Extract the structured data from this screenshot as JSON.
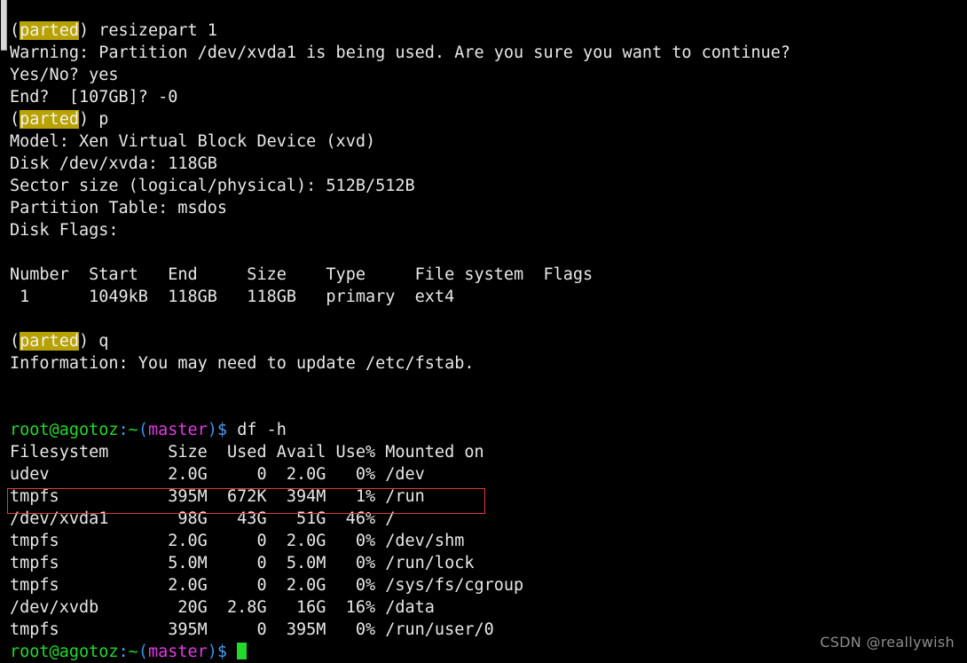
{
  "terminal": {
    "background": "#000000",
    "foreground": "#e8e8e8",
    "prompt_user_host": "root@agotoz",
    "prompt_colors": {
      "user_host": "#23d92c",
      "colon": "#4a9ef5",
      "path": "#23d92c",
      "paren": "#3a8fe8",
      "branch": "#e23be2",
      "dollar": "#4a9ef5"
    },
    "parted_highlight_bg": "#b8a200",
    "annotation_box_color": "#e03b3b",
    "cursor_color": "#23d92c"
  },
  "parted_session": {
    "prompt_open": "(",
    "prompt_name": "parted",
    "prompt_close": ") ",
    "cmd_resizepart": "resizepart 1",
    "warning": "Warning: Partition /dev/xvda1 is being used. Are you sure you want to continue?",
    "yesno_prompt": "Yes/No? yes",
    "end_prompt": "End?  [107GB]? -0",
    "cmd_print": "p",
    "cmd_quit": "q",
    "info": "Information: You may need to update /etc/fstab.",
    "disk_info": [
      "Model: Xen Virtual Block Device (xvd)",
      "Disk /dev/xvda: 118GB",
      "Sector size (logical/physical): 512B/512B",
      "Partition Table: msdos",
      "Disk Flags:"
    ],
    "partition_table": {
      "header": "Number  Start   End     Size    Type     File system  Flags",
      "rows": [
        " 1      1049kB  118GB   118GB   primary  ext4"
      ]
    }
  },
  "prompt_lines": {
    "line_df": {
      "user_host": "root@agotoz",
      "colon": ":",
      "path": "~",
      "open_paren": "(",
      "branch": "master",
      "close_paren": ")",
      "dollar": "$",
      "command": " df -h"
    },
    "line_last": {
      "user_host": "root@agotoz",
      "colon": ":",
      "path": "~",
      "open_paren": "(",
      "branch": "master",
      "close_paren": ")",
      "dollar": "$",
      "command": " "
    }
  },
  "df_output": {
    "header": "Filesystem      Size  Used Avail Use% Mounted on",
    "rows": [
      "udev            2.0G     0  2.0G   0% /dev",
      "tmpfs           395M  672K  394M   1% /run",
      "/dev/xvda1       98G   43G   51G  46% /",
      "tmpfs           2.0G     0  2.0G   0% /dev/shm",
      "tmpfs           5.0M     0  5.0M   0% /run/lock",
      "tmpfs           2.0G     0  2.0G   0% /sys/fs/cgroup",
      "/dev/xvdb        20G  2.8G   16G  16% /data",
      "tmpfs           395M     0  395M   0% /run/user/0"
    ],
    "highlighted_row_index": 2,
    "columns": [
      "Filesystem",
      "Size",
      "Used",
      "Avail",
      "Use%",
      "Mounted on"
    ],
    "parsed_rows": [
      {
        "filesystem": "udev",
        "size": "2.0G",
        "used": "0",
        "avail": "2.0G",
        "use_pct": "0%",
        "mounted_on": "/dev"
      },
      {
        "filesystem": "tmpfs",
        "size": "395M",
        "used": "672K",
        "avail": "394M",
        "use_pct": "1%",
        "mounted_on": "/run"
      },
      {
        "filesystem": "/dev/xvda1",
        "size": "98G",
        "used": "43G",
        "avail": "51G",
        "use_pct": "46%",
        "mounted_on": "/"
      },
      {
        "filesystem": "tmpfs",
        "size": "2.0G",
        "used": "0",
        "avail": "2.0G",
        "use_pct": "0%",
        "mounted_on": "/dev/shm"
      },
      {
        "filesystem": "tmpfs",
        "size": "5.0M",
        "used": "0",
        "avail": "5.0M",
        "use_pct": "0%",
        "mounted_on": "/run/lock"
      },
      {
        "filesystem": "tmpfs",
        "size": "2.0G",
        "used": "0",
        "avail": "2.0G",
        "use_pct": "0%",
        "mounted_on": "/sys/fs/cgroup"
      },
      {
        "filesystem": "/dev/xvdb",
        "size": "20G",
        "used": "2.8G",
        "avail": "16G",
        "use_pct": "16%",
        "mounted_on": "/data"
      },
      {
        "filesystem": "tmpfs",
        "size": "395M",
        "used": "0",
        "avail": "395M",
        "use_pct": "0%",
        "mounted_on": "/run/user/0"
      }
    ]
  },
  "watermark": "CSDN @reallywish"
}
